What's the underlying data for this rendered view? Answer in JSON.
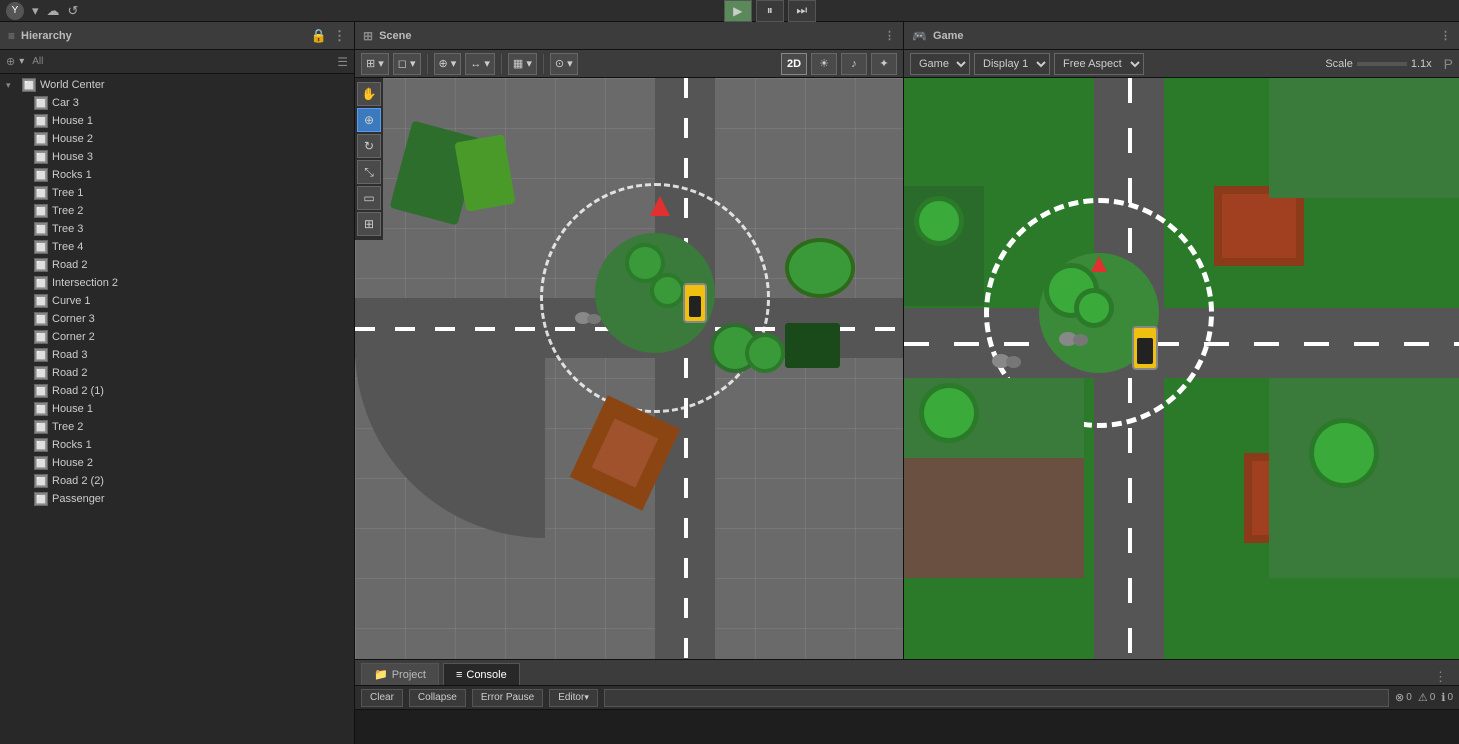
{
  "topbar": {
    "avatar_label": "Y",
    "cloud_icon": "☁",
    "history_icon": "↺"
  },
  "playback": {
    "play_label": "▶",
    "pause_label": "⏸",
    "step_label": "⏭"
  },
  "hierarchy": {
    "title": "Hierarchy",
    "search_placeholder": "All",
    "items": [
      {
        "label": "World Center",
        "depth": 1,
        "expandable": true
      },
      {
        "label": "Car 3",
        "depth": 2
      },
      {
        "label": "House 1",
        "depth": 2
      },
      {
        "label": "House 2",
        "depth": 2
      },
      {
        "label": "House 3",
        "depth": 2
      },
      {
        "label": "Rocks 1",
        "depth": 2
      },
      {
        "label": "Tree 1",
        "depth": 2
      },
      {
        "label": "Tree 2",
        "depth": 2
      },
      {
        "label": "Tree 3",
        "depth": 2
      },
      {
        "label": "Tree 4",
        "depth": 2
      },
      {
        "label": "Road 2",
        "depth": 2
      },
      {
        "label": "Intersection 2",
        "depth": 2
      },
      {
        "label": "Curve 1",
        "depth": 2
      },
      {
        "label": "Corner 3",
        "depth": 2
      },
      {
        "label": "Corner 2",
        "depth": 2
      },
      {
        "label": "Road 3",
        "depth": 2
      },
      {
        "label": "Road 2",
        "depth": 2
      },
      {
        "label": "Road 2 (1)",
        "depth": 2
      },
      {
        "label": "House 1",
        "depth": 2
      },
      {
        "label": "Tree 2",
        "depth": 2
      },
      {
        "label": "Rocks 1",
        "depth": 2
      },
      {
        "label": "House 2",
        "depth": 2
      },
      {
        "label": "Road 2 (2)",
        "depth": 2
      },
      {
        "label": "Passenger",
        "depth": 2
      }
    ]
  },
  "scene": {
    "title": "Scene",
    "toolbar": {
      "mode_btn": "⊞",
      "hand_tool": "✋",
      "move_tool": "⊕",
      "rotate_tool": "↻",
      "scale_tool": "⤡",
      "rect_tool": "▭",
      "transform_tool": "⊞",
      "gizmo_btn": "⊙",
      "2d_label": "2D",
      "light_icon": "☀",
      "audio_icon": "🎵"
    }
  },
  "game": {
    "title": "Game",
    "display_label": "Display 1",
    "aspect_label": "Free Aspect",
    "scale_label": "Scale",
    "scale_value": "1.1x"
  },
  "bottom": {
    "tabs": [
      {
        "label": "Project",
        "icon": "📁",
        "active": false
      },
      {
        "label": "Console",
        "icon": "≡",
        "active": true
      }
    ],
    "toolbar": {
      "clear_label": "Clear",
      "collapse_label": "Collapse",
      "error_pause_label": "Error Pause",
      "editor_label": "Editor",
      "search_placeholder": "",
      "error_count": "0",
      "warning_count": "0",
      "info_count": "0"
    }
  }
}
